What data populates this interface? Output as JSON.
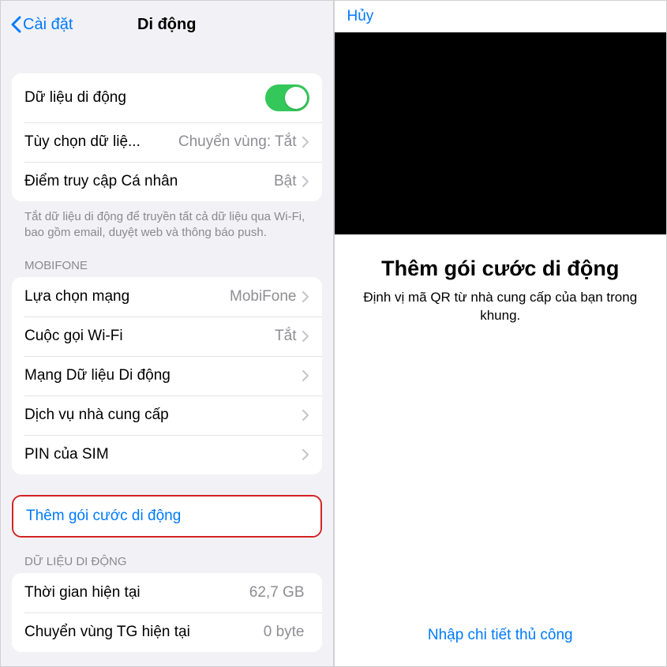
{
  "left": {
    "back_label": "Cài đặt",
    "title": "Di động",
    "group1": {
      "mobile_data_label": "Dữ liệu di động",
      "data_options_label": "Tùy chọn dữ liệ...",
      "data_options_value": "Chuyển vùng: Tắt",
      "hotspot_label": "Điểm truy cập Cá nhân",
      "hotspot_value": "Bật"
    },
    "group1_footer": "Tắt dữ liệu di động để truyền tất cả dữ liệu qua Wi-Fi, bao gồm email, duyệt web và thông báo push.",
    "carrier_header": "MOBIFONE",
    "group2": {
      "network_sel_label": "Lựa chọn mạng",
      "network_sel_value": "MobiFone",
      "wifi_calling_label": "Cuộc gọi Wi-Fi",
      "wifi_calling_value": "Tắt",
      "data_network_label": "Mạng Dữ liệu Di động",
      "carrier_services_label": "Dịch vụ nhà cung cấp",
      "sim_pin_label": "PIN của SIM"
    },
    "add_plan_label": "Thêm gói cước di động",
    "data_section_header": "DỮ LIỆU DI ĐỘNG",
    "group3": {
      "current_period_label": "Thời gian hiện tại",
      "current_period_value": "62,7 GB",
      "roaming_period_label": "Chuyển vùng TG hiện tại",
      "roaming_period_value": "0 byte"
    }
  },
  "right": {
    "cancel": "Hủy",
    "title": "Thêm gói cước di động",
    "subtitle": "Định vị mã QR từ nhà cung cấp của bạn trong khung.",
    "manual": "Nhập chi tiết thủ công"
  }
}
